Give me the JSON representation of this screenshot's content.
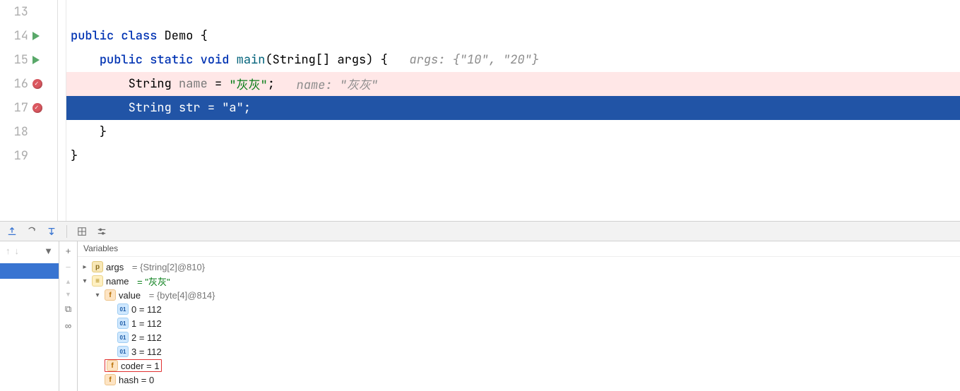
{
  "gutter": {
    "lines": [
      "13",
      "14",
      "15",
      "16",
      "17",
      "18",
      "19"
    ]
  },
  "code": {
    "l14": {
      "kw1": "public ",
      "kw2": "class ",
      "cls": "Demo ",
      "brace": "{"
    },
    "l15": {
      "indent": "    ",
      "kw1": "public ",
      "kw2": "static ",
      "kw3": "void ",
      "meth": "main",
      "open": "(",
      "ptype": "String[] ",
      "pname": "args",
      "close": ") {",
      "hint": "   args: {\"10\", \"20\"}"
    },
    "l16": {
      "indent": "        ",
      "type": "String ",
      "name": "name ",
      "eq": "= ",
      "str": "\"灰灰\"",
      "semi": ";",
      "hint": "   name: \"灰灰\""
    },
    "l17": {
      "indent": "        ",
      "type": "String ",
      "name": "str ",
      "eq": "= ",
      "str": "\"a\"",
      "semi": ";"
    },
    "l18": {
      "indent": "    ",
      "brace": "}"
    },
    "l19": {
      "brace": "}"
    }
  },
  "vars": {
    "header": "Variables",
    "args": {
      "name": "args",
      "value": "= {String[2]@810}"
    },
    "name": {
      "name": "name",
      "value": "= \"灰灰\""
    },
    "valuef": {
      "name": "value",
      "value": "= {byte[4]@814}"
    },
    "b0": {
      "label": "0 = 112"
    },
    "b1": {
      "label": "1 = 112"
    },
    "b2": {
      "label": "2 = 112"
    },
    "b3": {
      "label": "3 = 112"
    },
    "coder": {
      "label": "coder = 1"
    },
    "hash": {
      "label": "hash = 0"
    }
  },
  "icons": {
    "plus": "+",
    "minus": "−",
    "up": "▲",
    "down": "▼",
    "filter": "⏷",
    "copy": "⧉",
    "watch": "∞",
    "right": "▸",
    "downsm": "▾"
  }
}
